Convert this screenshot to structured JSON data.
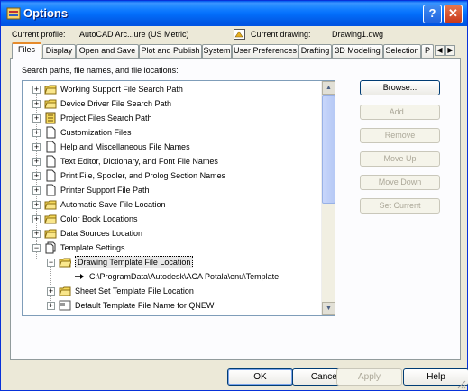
{
  "window": {
    "title": "Options",
    "help_glyph": "?",
    "close_glyph": "✕"
  },
  "profile": {
    "current_profile_label": "Current profile:",
    "current_profile_value": "AutoCAD Arc...ure (US Metric)",
    "current_drawing_label": "Current drawing:",
    "current_drawing_value": "Drawing1.dwg"
  },
  "tabs": [
    "Files",
    "Display",
    "Open and Save",
    "Plot and Publish",
    "System",
    "User Preferences",
    "Drafting",
    "3D Modeling",
    "Selection",
    "P"
  ],
  "tab_scroll": {
    "left": "◀",
    "right": "▶"
  },
  "section_label": "Search paths, file names, and file locations:",
  "tree": [
    {
      "label": "Working Support File Search Path"
    },
    {
      "label": "Device Driver File Search Path"
    },
    {
      "label": "Project Files Search Path"
    },
    {
      "label": "Customization Files"
    },
    {
      "label": "Help and Miscellaneous File Names"
    },
    {
      "label": "Text Editor, Dictionary, and Font File Names"
    },
    {
      "label": "Print File, Spooler, and Prolog Section Names"
    },
    {
      "label": "Printer Support File Path"
    },
    {
      "label": "Automatic Save File Location"
    },
    {
      "label": "Color Book Locations"
    },
    {
      "label": "Data Sources Location"
    },
    {
      "label": "Template Settings"
    },
    {
      "label": "Drawing Template File Location"
    },
    {
      "label": "C:\\ProgramData\\Autodesk\\ACA Potala\\enu\\Template"
    },
    {
      "label": "Sheet Set Template File Location"
    },
    {
      "label": "Default Template File Name for QNEW"
    }
  ],
  "side_buttons": {
    "browse": "Browse...",
    "add": "Add...",
    "remove": "Remove",
    "move_up": "Move Up",
    "move_down": "Move Down",
    "set_current": "Set Current"
  },
  "footer": {
    "ok": "OK",
    "cancel": "Cancel",
    "apply": "Apply",
    "help": "Help"
  },
  "scroll": {
    "up": "▲",
    "down": "▼"
  },
  "colors": {
    "title_bar": "#0054e3",
    "panel": "#fcfcfe",
    "dialog": "#ece9d8",
    "active_tab_accent": "#e68b2c"
  },
  "icons": [
    "folder-icon",
    "document-icon",
    "template-icon",
    "arrow-path-icon"
  ]
}
